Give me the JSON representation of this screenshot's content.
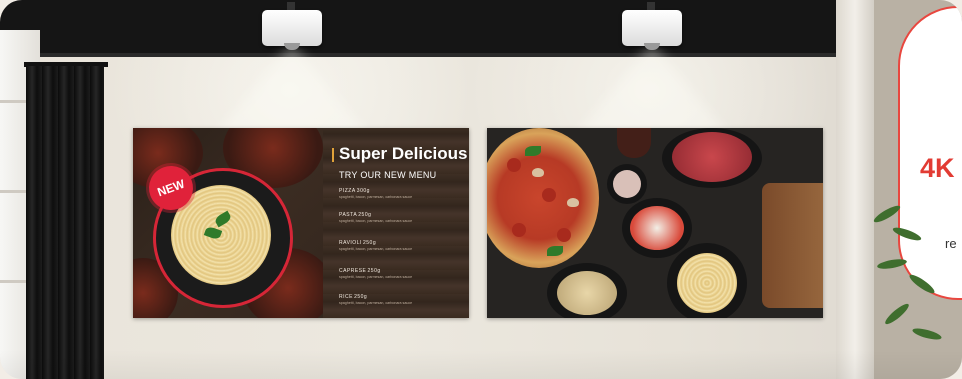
{
  "promo": {
    "title": "4K",
    "subtitle": "re"
  },
  "menu_board": {
    "badge": "NEW",
    "title": "Super Delicious",
    "subtitle": "TRY OUR NEW MENU",
    "items": [
      {
        "name": "PIZZA",
        "price": "300g",
        "desc": "spaghetti, bacon, parmesan, carbonara sauce"
      },
      {
        "name": "PASTA",
        "price": "250g",
        "desc": "spaghetti, bacon, parmesan, carbonara sauce"
      },
      {
        "name": "RAVIOLI",
        "price": "250g",
        "desc": "spaghetti, bacon, parmesan, carbonara sauce"
      },
      {
        "name": "CAPRESE",
        "price": "250g",
        "desc": "spaghetti, bacon, parmesan, carbonara sauce"
      },
      {
        "name": "RICE",
        "price": "250g",
        "desc": "spaghetti, bacon, parmesan, carbonara sauce"
      }
    ]
  },
  "colors": {
    "accent_red": "#e0223a",
    "promo_red": "#e23b33",
    "ceiling": "#151515",
    "wall": "#ece8df"
  }
}
